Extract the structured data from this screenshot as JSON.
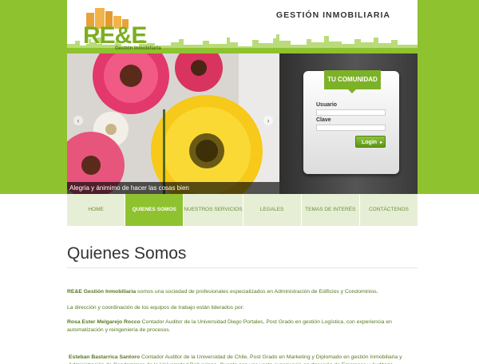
{
  "header": {
    "logo_text": "RE&E",
    "logo_subtitle": "Gestión Inmobiliaria",
    "brand_title": "GESTIÓN INMOBILIARIA"
  },
  "slider": {
    "caption": "Alegria y ánimimo de hacer las cosas bien",
    "prev_icon": "‹",
    "next_icon": "›"
  },
  "login": {
    "tab_label": "TU COMUNIDAD",
    "user_label": "Usuario",
    "user_value": "",
    "password_label": "Clave",
    "password_value": "",
    "button_label": "Login",
    "button_icon": "▸"
  },
  "nav": {
    "items": [
      {
        "label": "HOME"
      },
      {
        "label": "QUIENES SOMOS"
      },
      {
        "label": "NUESTROS SERVICIOS"
      },
      {
        "label": "LEGALES"
      },
      {
        "label": "TEMAS DE INTERÉS"
      },
      {
        "label": "CONTÁCTENOS"
      }
    ],
    "active_index": 1
  },
  "content": {
    "title": "Quienes Somos",
    "intro_bold": "RE&E Gestión Inmobiliaria",
    "intro_rest": " somos  una sociedad de profesionales especializados en Administración de Edificios y Condominios.",
    "lead": "La dirección y coordinación de los equipos de trabajo están liderados por:",
    "person1_name": "Rosa Ester Melgarejo Rocco",
    "person1_desc": "  Contador Auditor de la Universidad Diego Portales, Post Grado en gestión Logística, con experiencia en automatización y reingeniería de procesos.",
    "person2_name": "Esteban Bastarrica Santoro",
    "person2_desc": "  Contador Auditor de la Universidad de Chile,  Post Grado en Marketing y Diplomado en gestión Inmobiliaria y Administración de Condominios de la Universidad Bolivariana. Cuenta con una vasta experiencia en dirección de  Empresas y Auditoria"
  },
  "colors": {
    "brand_green": "#8fc22f",
    "nav_bg": "#e6efd5",
    "text_green": "#55781f"
  }
}
